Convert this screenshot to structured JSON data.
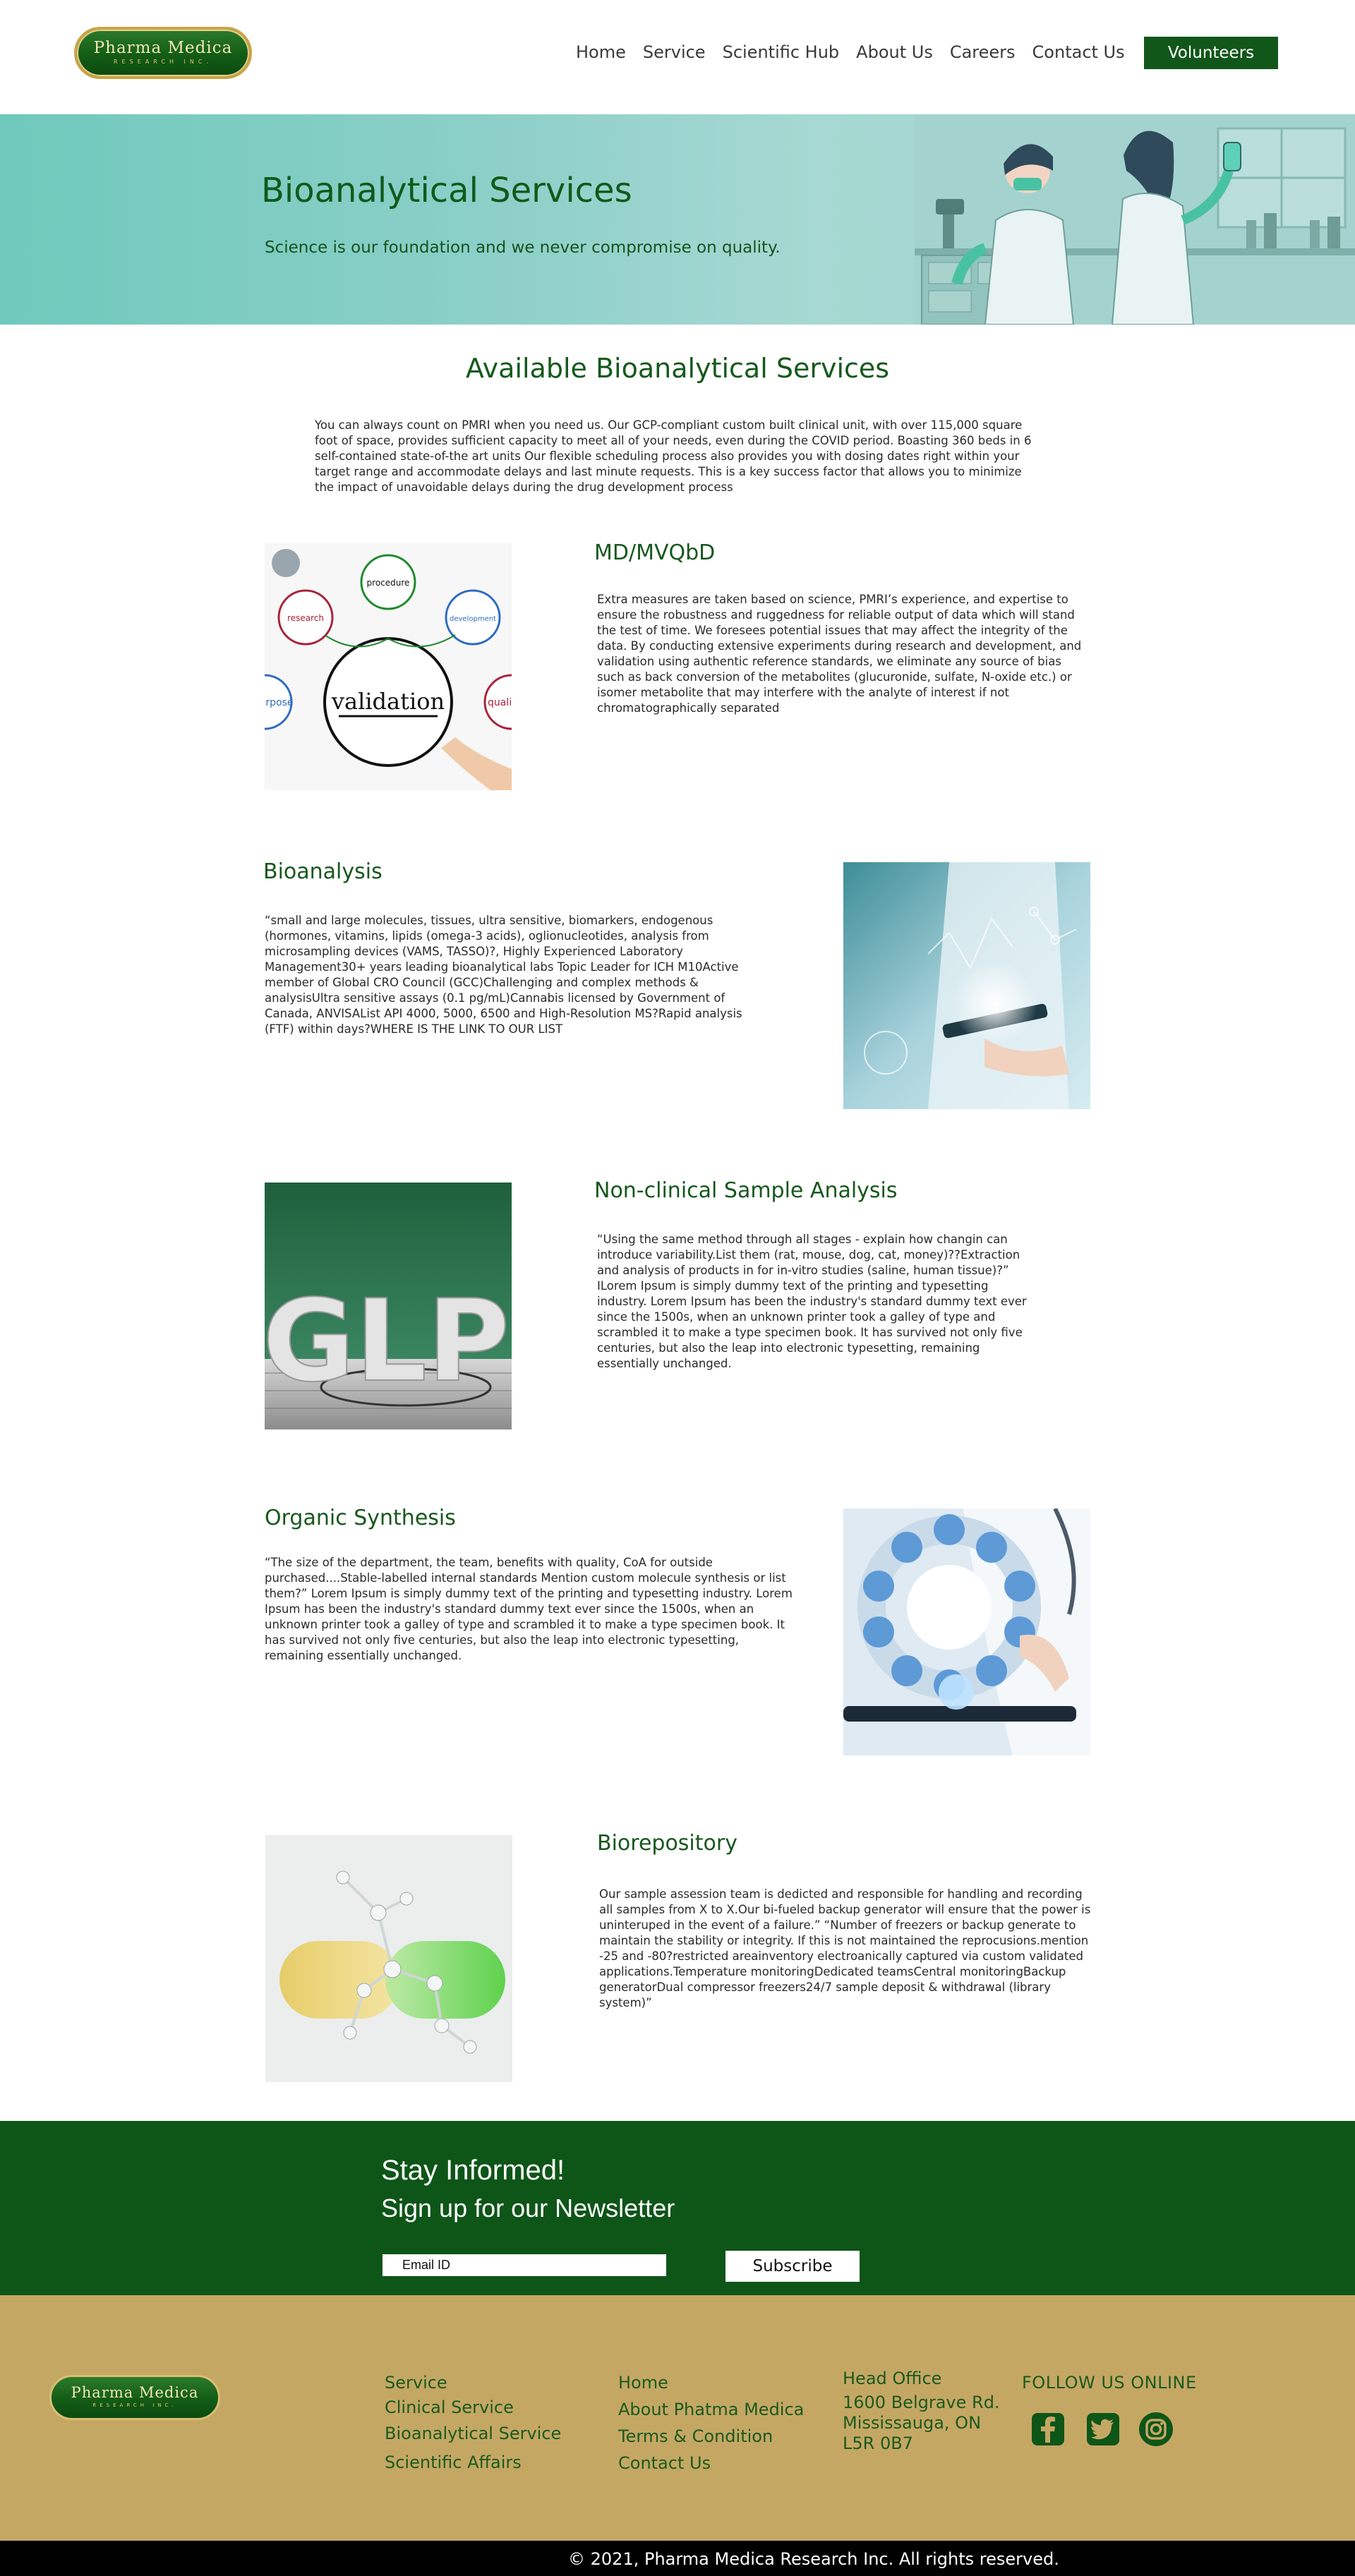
{
  "header": {
    "logo": {
      "line1": "Pharma Medica",
      "line2": "RESEARCH INC."
    },
    "nav": [
      "Home",
      "Service",
      "Scientific Hub",
      "About Us",
      "Careers",
      "Contact Us"
    ],
    "cta": "Volunteers"
  },
  "hero": {
    "title": "Bioanalytical Services",
    "subtitle": "Science is our foundation and we never compromise on quality."
  },
  "intro": {
    "title": "Available Bioanalytical Services",
    "text": "You can always count on PMRI when you need us. Our GCP-compliant custom built clinical unit, with over 115,000 square foot of space, provides sufficient capacity to meet all of your needs, even during the COVID period. Boasting 360 beds in 6 self-contained state-of-the art units Our flexible scheduling process also provides you with dosing dates right within your target range and accommodate delays and last minute requests. This is a key success factor that allows you to minimize the impact of unavoidable delays during the drug development process"
  },
  "services": [
    {
      "title": "MD/MVQbD",
      "image": "validation-illustration",
      "image_words": [
        "procedure",
        "research",
        "development",
        "validation",
        "purpose",
        "quality"
      ],
      "text": "Extra measures are taken based on science, PMRI’s experience, and expertise to ensure the robustness and ruggedness for reliable output of data which will stand the test of time. We foresees potential issues that may affect the integrity of the data. By conducting extensive experiments during research and development, and validation using authentic reference standards, we eliminate any source of bias such as back conversion of the metabolites (glucuronide, sulfate, N-oxide etc.) or isomer metabolite that may interfere with the analyte of interest if not chromatographically separated"
    },
    {
      "title": "Bioanalysis",
      "image": "tablet-scientist-photo",
      "text": "“small and large molecules, tissues, ultra sensitive, biomarkers, endogenous (hormones, vitamins, lipids (omega-3 acids), oglionucleotides, analysis from microsampling devices (VAMS, TASSO)?, Highly Experienced Laboratory Management30+ years leading bioanalytical labs Topic Leader for ICH M10Active member of Global CRO Council (GCC)Challenging and complex methods & analysisUltra sensitive assays (0.1 pg/mL)Cannabis licensed by Government of Canada, ANVISAList API 4000, 5000, 6500 and High-Resolution MS?Rapid analysis (FTF) within days?WHERE IS THE LINK TO OUR LIST"
    },
    {
      "title": "Non-clinical Sample Analysis",
      "image": "glp-3d-letters",
      "image_words": [
        "GLP"
      ],
      "text": "“Using the same method through all stages - explain how changin can introduce variability.List them (rat, mouse, dog, cat, money)??Extraction and analysis of products in for in-vitro studies (saline, human tissue)?” ILorem Ipsum is simply dummy text of the printing and typesetting industry. Lorem Ipsum has been the industry's standard dummy text ever since the 1500s, when an unknown printer took a galley of type and scrambled it to make a type specimen book. It has survived not only five centuries, but also the leap into electronic typesetting, remaining essentially unchanged."
    },
    {
      "title": "Organic Synthesis",
      "image": "medical-icons-photo",
      "text": "“The size of the department, the team, benefits with quality, CoA for outside purchased....Stable-labelled internal standards Mention custom molecule synthesis or list them?” Lorem Ipsum is simply dummy text of the printing and typesetting industry. Lorem Ipsum has been the industry's standard dummy text ever since the 1500s, when an unknown printer took a galley of type and scrambled it to make a type specimen book. It has survived not only five centuries, but also the leap into electronic typesetting, remaining essentially unchanged."
    },
    {
      "title": "Biorepository",
      "image": "capsule-molecule-render",
      "text": "Our sample assession team is dedicted and responsible for handling and recording all samples from X to X.Our bi-fueled backup generator will ensure that the power is uninteruped in the event of a failure.” “Number of freezers or backup generate to maintain the stability or integrity. If this is not maintained the reprocusions.mention -25 and -80?restricted areainventory electroanically captured via custom validated applications.Temperature monitoringDedicated teamsCentral monitoringBackup generatorDual compressor freezers24/7 sample deposit & withdrawal (library system)”"
    }
  ],
  "newsletter": {
    "heading": "Stay Informed!",
    "subheading": "Sign up for our Newsletter",
    "email_placeholder": "Email ID",
    "button": "Subscribe"
  },
  "footer": {
    "col1": [
      "Service",
      "Clinical Service",
      "Bioanalytical Service",
      "Scientific Affairs"
    ],
    "col2": [
      "Home",
      "About Phatma Medica",
      "Terms & Condition",
      "Contact Us"
    ],
    "address_title": "Head Office",
    "address_lines": [
      "1600 Belgrave Rd.",
      "Mississauga, ON",
      "L5R 0B7"
    ],
    "follow": "FOLLOW US ONLINE",
    "social_icons": [
      "facebook-icon",
      "twitter-icon",
      "instagram-icon"
    ],
    "copyright": "© 2021, Pharma Medica Research Inc. All rights reserved."
  },
  "colors": {
    "brand_green": "#11571a",
    "footer_gold": "#c5a764",
    "hero_teal": "#8bcfc8"
  }
}
